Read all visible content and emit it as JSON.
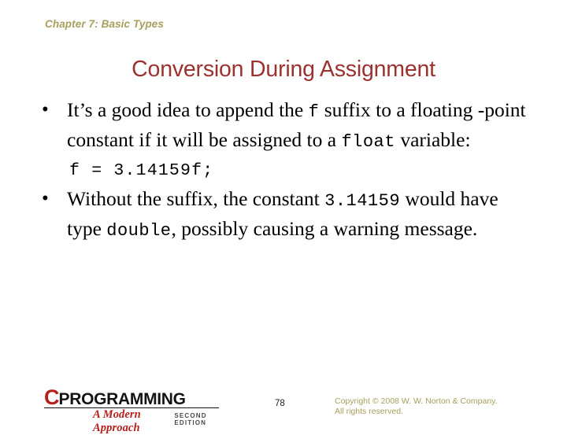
{
  "slide": {
    "chapter_header": "Chapter 7: Basic Types",
    "title": "Conversion During Assignment",
    "page_number": "78",
    "colors": {
      "background": "#ffffff",
      "header_olive": "#a89f5e",
      "title_red": "#9c322f",
      "body_black": "#000000",
      "logo_red": "#b5201d"
    }
  },
  "body": {
    "bullets": [
      {
        "marker": "•",
        "parts": [
          {
            "type": "text",
            "value": "It’s a good idea to append the "
          },
          {
            "type": "code",
            "value": "f"
          },
          {
            "type": "text",
            "value": " suffix to a floating -point constant if it will be assigned to a "
          },
          {
            "type": "code",
            "value": "float"
          },
          {
            "type": "text",
            "value": " variable:"
          }
        ],
        "plain": "It’s a good idea to append the f suffix to a floating -point constant if it will be assigned to a float variable:"
      },
      {
        "marker": "•",
        "parts": [
          {
            "type": "text",
            "value": "Without the suffix, the constant "
          },
          {
            "type": "code",
            "value": "3.14159"
          },
          {
            "type": "text",
            "value": " would have type "
          },
          {
            "type": "code",
            "value": "double"
          },
          {
            "type": "text",
            "value": ", possibly causing a warning message."
          }
        ],
        "plain": "Without the suffix, the constant 3.14159 would have type double, possibly causing a warning message."
      }
    ],
    "code_sample": "f = 3.14159f;"
  },
  "footer": {
    "logo": {
      "initial": "C",
      "word": "PROGRAMMING",
      "tagline": "A Modern Approach",
      "edition": "Second Edition"
    },
    "copyright_line_1": "Copyright © 2008 W. W. Norton & Company.",
    "copyright_line_2": "All rights reserved."
  }
}
